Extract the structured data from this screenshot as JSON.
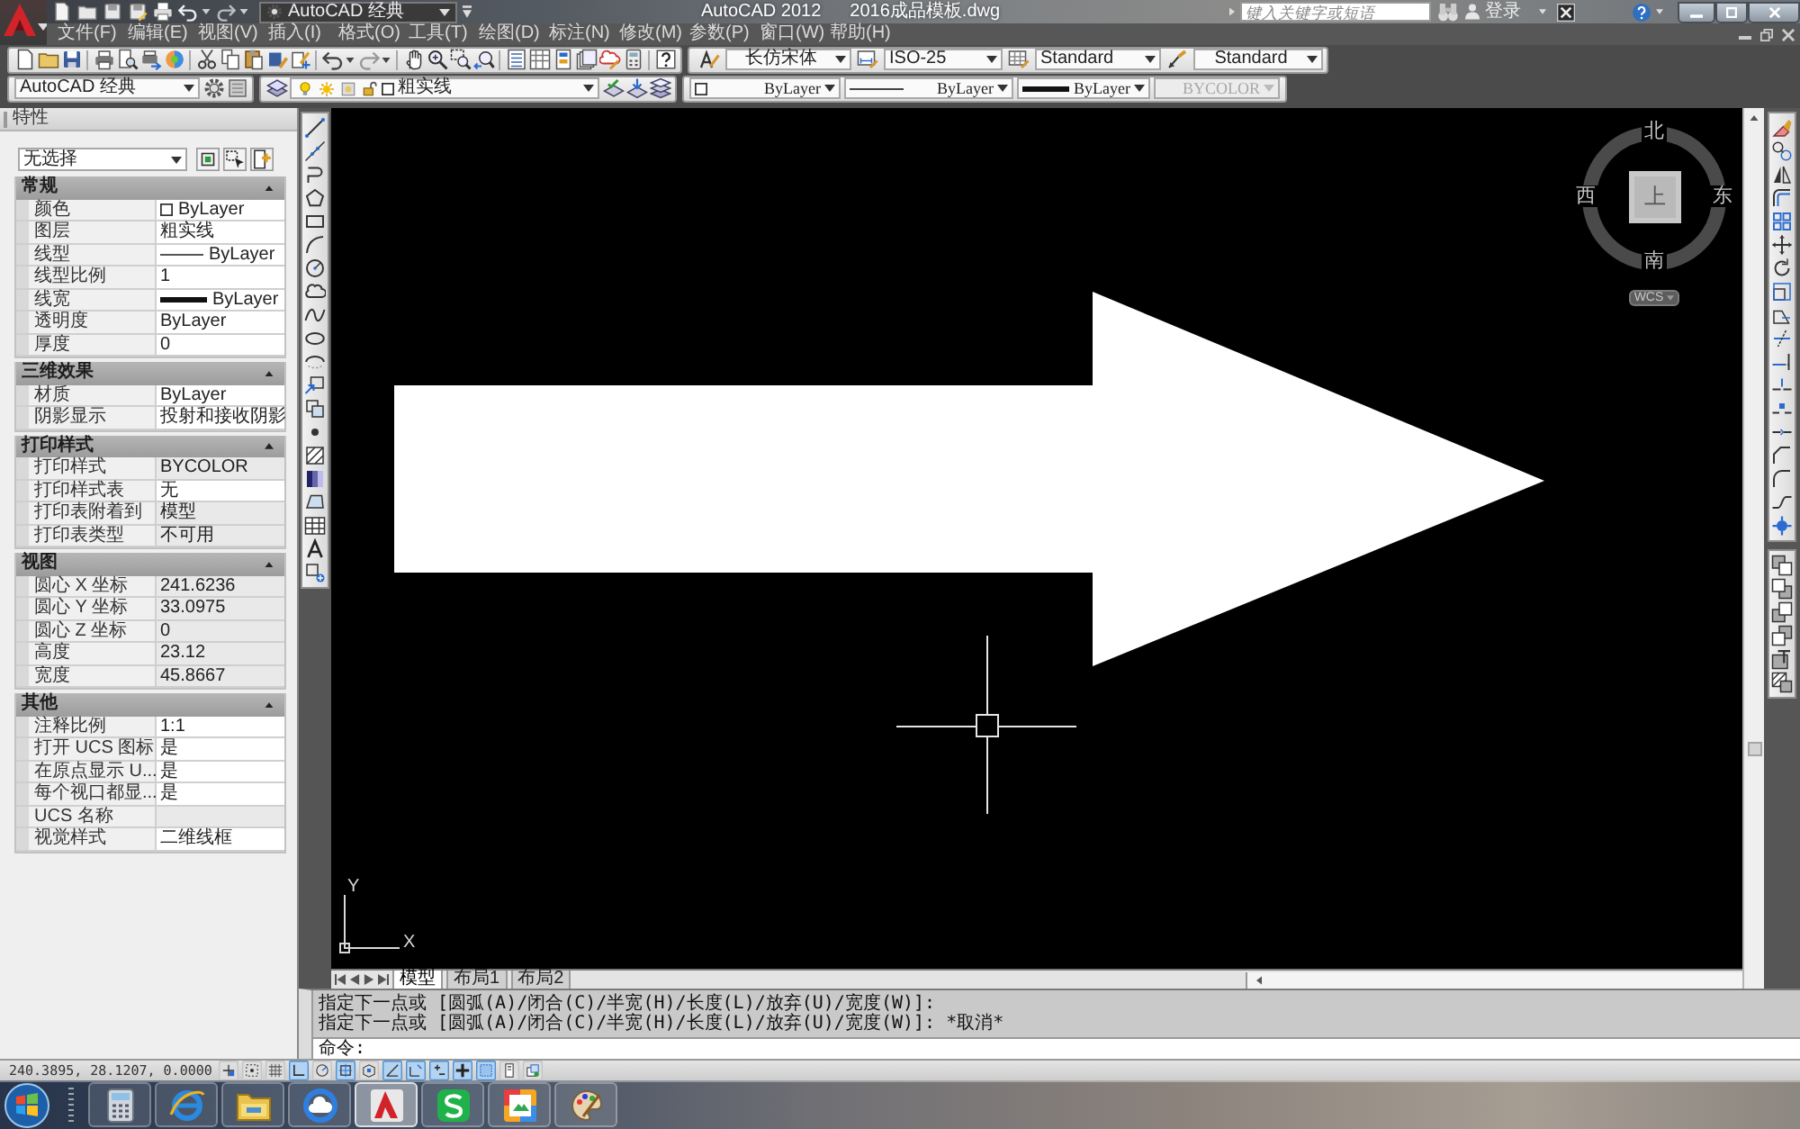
{
  "title_bar": {
    "workspace": "AutoCAD 经典",
    "app_name": "AutoCAD 2012",
    "file_name": "2016成品模板.dwg",
    "search": {
      "placeholder": "键入关键字或短语"
    },
    "sign_in": "登录"
  },
  "menu_bar": [
    "文件(F)",
    "编辑(E)",
    "视图(V)",
    "插入(I)",
    "格式(O)",
    "工具(T)",
    "绘图(D)",
    "标注(N)",
    "修改(M)",
    "参数(P)",
    "窗口(W)",
    "帮助(H)"
  ],
  "toolbars": {
    "text_style": "长仿宋体",
    "dim_style": "ISO-25",
    "table_style": "Standard",
    "multileader_style": "Standard",
    "workspace": "AutoCAD 经典",
    "layer": "粗实线",
    "object_color": "ByLayer",
    "linetype": "ByLayer",
    "lineweight": "ByLayer",
    "plot_style": {
      "value": "BYCOLOR",
      "disabled": true
    }
  },
  "properties": {
    "title": "特性",
    "selection": "无选择",
    "sections": [
      {
        "title": "常规",
        "expanded": true,
        "rows": [
          {
            "label": "颜色",
            "value": "ByLayer",
            "kind": "color",
            "readonly": false
          },
          {
            "label": "图层",
            "value": "粗实线",
            "kind": "text",
            "readonly": false
          },
          {
            "label": "线型",
            "value": "ByLayer",
            "kind": "linetype",
            "readonly": false
          },
          {
            "label": "线型比例",
            "value": "1",
            "kind": "text",
            "readonly": false
          },
          {
            "label": "线宽",
            "value": "ByLayer",
            "kind": "lineweight",
            "readonly": false
          },
          {
            "label": "透明度",
            "value": "ByLayer",
            "kind": "text",
            "readonly": false
          },
          {
            "label": "厚度",
            "value": "0",
            "kind": "text",
            "readonly": false
          }
        ]
      },
      {
        "title": "三维效果",
        "expanded": true,
        "rows": [
          {
            "label": "材质",
            "value": "ByLayer",
            "kind": "text",
            "readonly": false
          },
          {
            "label": "阴影显示",
            "value": "投射和接收阴影",
            "kind": "text",
            "readonly": false
          }
        ]
      },
      {
        "title": "打印样式",
        "expanded": true,
        "rows": [
          {
            "label": "打印样式",
            "value": "BYCOLOR",
            "kind": "text",
            "readonly": true
          },
          {
            "label": "打印样式表",
            "value": "无",
            "kind": "text",
            "readonly": false
          },
          {
            "label": "打印表附着到",
            "value": "模型",
            "kind": "text",
            "readonly": true
          },
          {
            "label": "打印表类型",
            "value": "不可用",
            "kind": "text",
            "readonly": true
          }
        ]
      },
      {
        "title": "视图",
        "expanded": true,
        "rows": [
          {
            "label": "圆心 X 坐标",
            "value": "241.6236",
            "kind": "text",
            "readonly": true
          },
          {
            "label": "圆心 Y 坐标",
            "value": "33.0975",
            "kind": "text",
            "readonly": true
          },
          {
            "label": "圆心 Z 坐标",
            "value": "0",
            "kind": "text",
            "readonly": true
          },
          {
            "label": "高度",
            "value": "23.12",
            "kind": "text",
            "readonly": true
          },
          {
            "label": "宽度",
            "value": "45.8667",
            "kind": "text",
            "readonly": true
          }
        ]
      },
      {
        "title": "其他",
        "expanded": true,
        "rows": [
          {
            "label": "注释比例",
            "value": "1:1",
            "kind": "text",
            "readonly": false
          },
          {
            "label": "打开 UCS 图标",
            "value": "是",
            "kind": "text",
            "readonly": false
          },
          {
            "label": "在原点显示 U...",
            "value": "是",
            "kind": "text",
            "readonly": false
          },
          {
            "label": "每个视口都显...",
            "value": "是",
            "kind": "text",
            "readonly": false
          },
          {
            "label": "UCS 名称",
            "kind": "text",
            "readonly": true
          },
          {
            "label": "视觉样式",
            "value": "二维线框",
            "kind": "text",
            "readonly": false
          }
        ]
      }
    ]
  },
  "viewcube": {
    "face": "上",
    "north": "北",
    "south": "南",
    "west": "西",
    "east": "东",
    "ucs_menu": "WCS"
  },
  "ucs_icon": {
    "x_label": "X",
    "y_label": "Y"
  },
  "layout_tabs": [
    {
      "label": "模型",
      "selected": true
    },
    {
      "label": "布局1",
      "selected": false
    },
    {
      "label": "布局2",
      "selected": false
    }
  ],
  "command_line": {
    "history": [
      "指定下一点或 [圆弧(A)/闭合(C)/半宽(H)/长度(L)/放弃(U)/宽度(W)]:",
      "指定下一点或 [圆弧(A)/闭合(C)/半宽(H)/长度(L)/放弃(U)/宽度(W)]: *取消*"
    ],
    "prompt": "命令:"
  },
  "status_bar": {
    "coordinates": "240.3895, 28.1207, 0.0000",
    "toggles": [
      {
        "on": false
      },
      {
        "on": false
      },
      {
        "on": false
      },
      {
        "on": true
      },
      {
        "on": false
      },
      {
        "on": true
      },
      {
        "on": false
      },
      {
        "on": true
      },
      {
        "on": true
      },
      {
        "on": true
      },
      {
        "on": true
      },
      {
        "on": true
      },
      {
        "on": false
      },
      {
        "on": false
      }
    ]
  },
  "taskbar": {
    "buttons": [
      {
        "selected": false
      },
      {
        "selected": false
      },
      {
        "selected": false
      },
      {
        "selected": false
      },
      {
        "selected": true
      },
      {
        "selected": false
      },
      {
        "selected": false
      },
      {
        "selected": false
      }
    ]
  }
}
